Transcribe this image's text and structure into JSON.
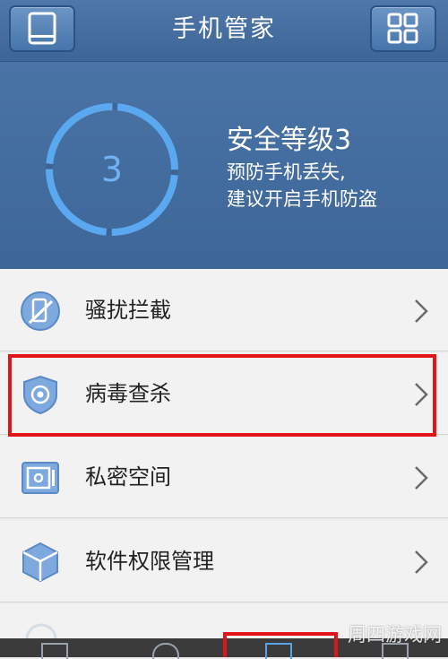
{
  "header": {
    "title": "手机管家",
    "left_icon": "tablet-icon",
    "right_icon": "grid-icon"
  },
  "security": {
    "level_number": "3",
    "level_title": "安全等级3",
    "advice_line1": "预防手机丢失,",
    "advice_line2": "建议开启手机防盗",
    "gauge_color": "#5aa8f0"
  },
  "menu": {
    "items": [
      {
        "label": "骚扰拦截",
        "icon": "phone-block-icon"
      },
      {
        "label": "病毒查杀",
        "icon": "shield-target-icon"
      },
      {
        "label": "私密空间",
        "icon": "safe-icon"
      },
      {
        "label": "软件权限管理",
        "icon": "cube-icon"
      }
    ]
  },
  "watermark": "周四游戏网",
  "colors": {
    "header_bg": "#4a73a6",
    "highlight": "#e3131a",
    "accent": "#5aa8f0"
  }
}
